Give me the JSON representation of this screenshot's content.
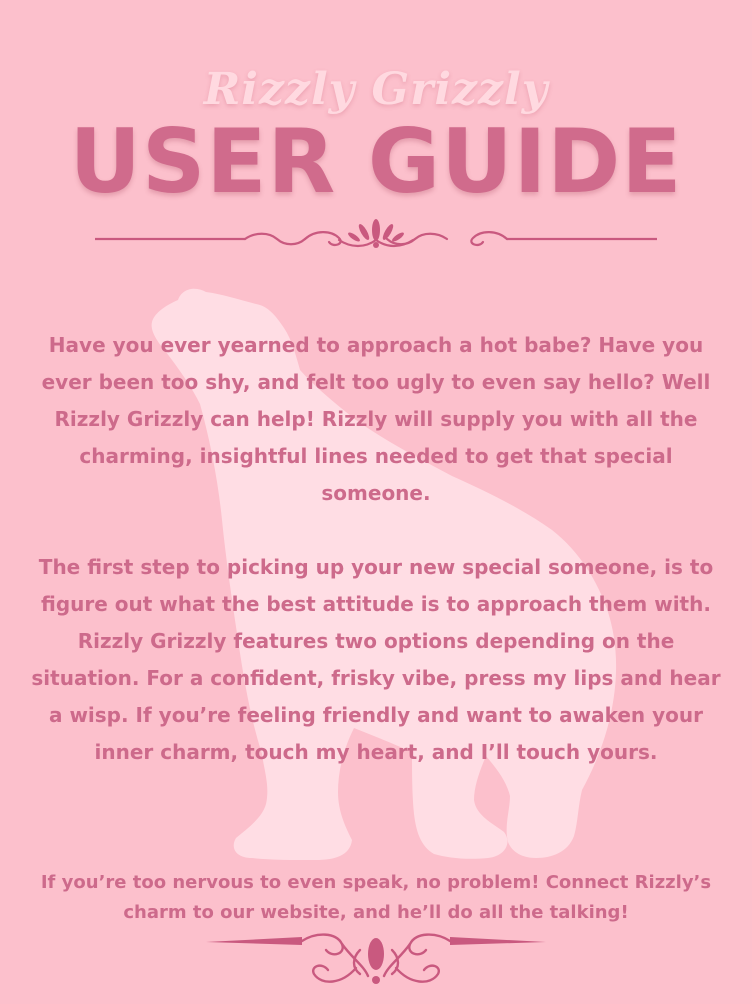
{
  "header": {
    "subtitle": "Rizzly Grizzly",
    "title": "USER GUIDE"
  },
  "body": {
    "paragraph_1": "Have you ever yearned to approach a hot babe? Have you ever been too shy, and felt too ugly to even say hello? Well Rizzly Grizzly can help! Rizzly will supply you with all the charming, insightful lines needed to get that special someone.",
    "paragraph_2": "The first step to picking up your new special someone, is to figure out what the best attitude is to approach them with. Rizzly Grizzly features two options depending on the situation. For a confident, frisky vibe, press my lips and hear a wisp. If you’re feeling friendly and want to awaken your inner charm, touch my heart, and I’ll touch yours.",
    "paragraph_3": "If you’re too nervous to even speak, no problem! Connect Rizzly’s charm to our website, and he’ll do all the talking!"
  },
  "icons": {
    "background": "polar-bear-silhouette-icon",
    "top_divider": "flourish-divider-icon",
    "bottom_divider": "flourish-divider-icon"
  },
  "colors": {
    "background": "#fcc0cc",
    "title": "#d06b8c",
    "subtitle": "#ffd9e0",
    "body_text": "#cd6a8b",
    "bear": "#ffdde4",
    "ornament": "#c9597f"
  }
}
